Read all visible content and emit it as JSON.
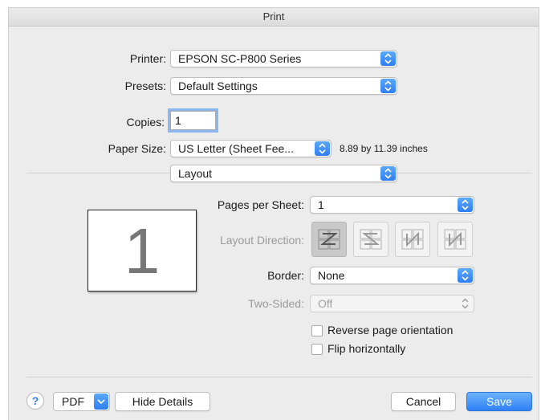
{
  "window": {
    "title": "Print"
  },
  "printer": {
    "label": "Printer:",
    "value": "EPSON SC-P800 Series"
  },
  "presets": {
    "label": "Presets:",
    "value": "Default Settings"
  },
  "copies": {
    "label": "Copies:",
    "value": "1"
  },
  "paper_size": {
    "label": "Paper Size:",
    "value": "US Letter (Sheet Fee...",
    "dimensions": "8.89 by 11.39 inches"
  },
  "section": {
    "value": "Layout"
  },
  "preview": {
    "page_number": "1"
  },
  "pages_per_sheet": {
    "label": "Pages per Sheet:",
    "value": "1"
  },
  "layout_direction": {
    "label": "Layout Direction:",
    "options": [
      "z-order",
      "reverse-z-order",
      "n-order",
      "reverse-n-order"
    ],
    "selected": 0
  },
  "border": {
    "label": "Border:",
    "value": "None"
  },
  "two_sided": {
    "label": "Two-Sided:",
    "value": "Off"
  },
  "reverse_orientation": {
    "label": "Reverse page orientation",
    "checked": false
  },
  "flip_horizontally": {
    "label": "Flip horizontally",
    "checked": false
  },
  "footer": {
    "help_label": "?",
    "pdf_label": "PDF",
    "hide_details_label": "Hide Details",
    "cancel_label": "Cancel",
    "save_label": "Save"
  },
  "colors": {
    "accent": "#2f7ff3",
    "window_bg": "#ececec",
    "disabled_text": "#9a9a9a"
  }
}
